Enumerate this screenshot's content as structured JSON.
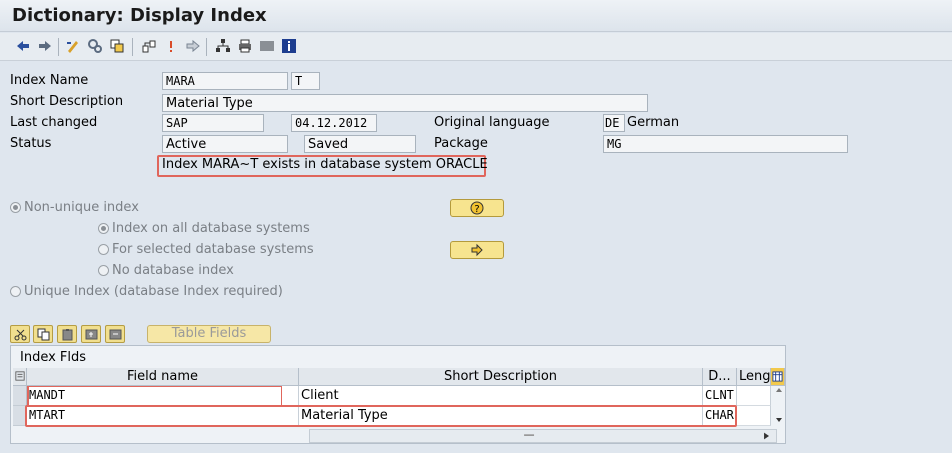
{
  "window": {
    "title": "Dictionary: Display Index"
  },
  "toolbar": {
    "icons": [
      "back-arrow-icon",
      "forward-arrow-icon",
      "display-change-icon",
      "activate-icon",
      "object-list-icon",
      "where-used-icon",
      "position-icon",
      "navigate-icon",
      "hierarchy-icon",
      "print-icon",
      "grey-box-icon",
      "info-icon"
    ]
  },
  "header": {
    "index_name_label": "Index Name",
    "index_name_value": "MARA",
    "index_id_value": "T",
    "short_desc_label": "Short Description",
    "short_desc_value": "Material Type",
    "last_changed_label": "Last changed",
    "last_changed_user": "SAP",
    "last_changed_date": "04.12.2012",
    "orig_lang_label": "Original language",
    "orig_lang_code": "DE",
    "orig_lang_name": "German",
    "status_label": "Status",
    "status_value": "Active",
    "status_saved": "Saved",
    "package_label": "Package",
    "package_value": "MG",
    "message": "Index MARA~T exists in database system ORACLE"
  },
  "options": {
    "non_unique": "Non-unique index",
    "all_db": "Index on all database systems",
    "selected_db": "For selected database systems",
    "no_db": "No database index",
    "unique": "Unique Index (database Index required)"
  },
  "table_toolbar": {
    "table_fields_label": "Table Fields"
  },
  "table": {
    "title": "Index Flds",
    "columns": [
      "Field name",
      "Short Description",
      "D...",
      "Leng"
    ],
    "rows": [
      {
        "field": "MANDT",
        "desc": "Client",
        "dtype": "CLNT"
      },
      {
        "field": "MTART",
        "desc": "Material Type",
        "dtype": "CHAR"
      }
    ]
  }
}
